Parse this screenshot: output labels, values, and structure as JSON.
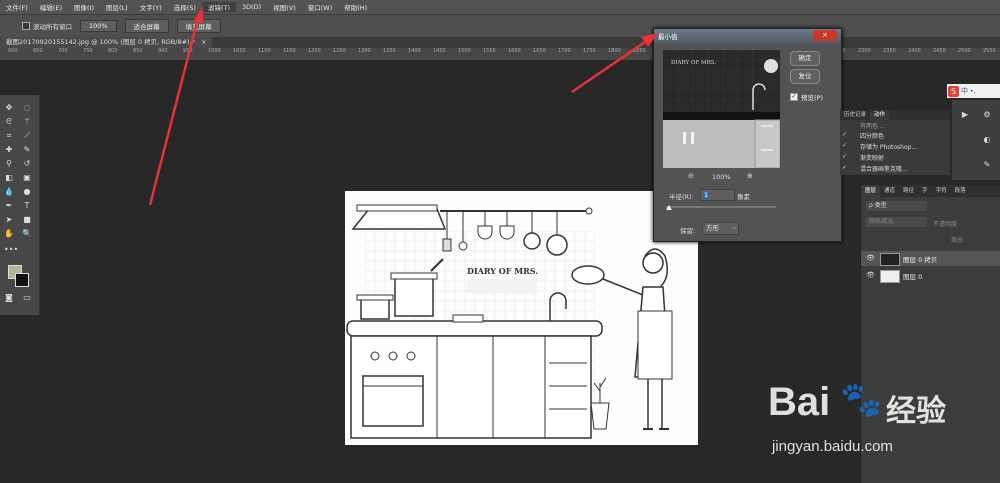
{
  "menu": {
    "items": [
      "文件(F)",
      "编辑(E)",
      "图像(I)",
      "图层(L)",
      "文字(Y)",
      "选择(S)",
      "滤镜(T)",
      "3D(D)",
      "视图(V)",
      "窗口(W)",
      "帮助(H)"
    ]
  },
  "options": {
    "scroll_all_label": "滚动所有窗口",
    "zoom_value": "100%",
    "fit_screen_label": "适合屏幕",
    "fill_screen_label": "填充屏幕"
  },
  "document": {
    "tab_title": "截图20170920155142.jpg @ 100% (图层 0 拷贝, RGB/8#) *",
    "tab_close": "×"
  },
  "ruler": {
    "ticks": [
      "600",
      "650",
      "700",
      "750",
      "800",
      "850",
      "900",
      "950",
      "1000",
      "1050",
      "1100",
      "1150",
      "1200",
      "1250",
      "1300",
      "1350",
      "1400",
      "1450",
      "1500",
      "1550",
      "1600",
      "1650",
      "1700",
      "1750",
      "1800",
      "1850",
      "1900",
      "1950",
      "2000",
      "2050",
      "2100",
      "2150",
      "2200",
      "2250",
      "2300",
      "2350",
      "2400",
      "2450",
      "2500",
      "2550"
    ]
  },
  "artwork": {
    "title": "DIARY OF MRS."
  },
  "dialog": {
    "title": "最小值",
    "close": "×",
    "ok_label": "确定",
    "reset_label": "复位",
    "preview_label": "预览(P)",
    "zoom_out": "⊖",
    "zoom_value": "100%",
    "zoom_in": "⊕",
    "radius_label": "半径(R):",
    "radius_value": "1",
    "radius_unit": "像素",
    "preserve_label": "保留:",
    "preserve_value": "方形"
  },
  "history_panel": {
    "tabs": [
      "历史记录",
      "动作"
    ],
    "rows": [
      "四分颜色",
      "存储为 Photoshop...",
      "渐变映射",
      "混合器画笔克隆..."
    ],
    "partial_row": "有两色 ..."
  },
  "layers_panel": {
    "tabs": [
      "图层",
      "通道",
      "路径",
      "字",
      "字符",
      "段落"
    ],
    "kind_label": "ρ 类型",
    "mode_label": "颜色减淡",
    "opacity_label": "不透明度",
    "fill_label": "填充",
    "layers": [
      {
        "name": "图层 0 拷贝",
        "selected": true
      },
      {
        "name": "图层 0",
        "selected": false
      }
    ]
  },
  "tray": {
    "ime": "中",
    "ime_extra": "•,"
  },
  "watermark": {
    "brand": "Bai",
    "brand_cn": "经验",
    "url": "jingyan.baidu.com"
  },
  "colors": {
    "arrow": "#e8303a",
    "accent": "#c7392a"
  }
}
